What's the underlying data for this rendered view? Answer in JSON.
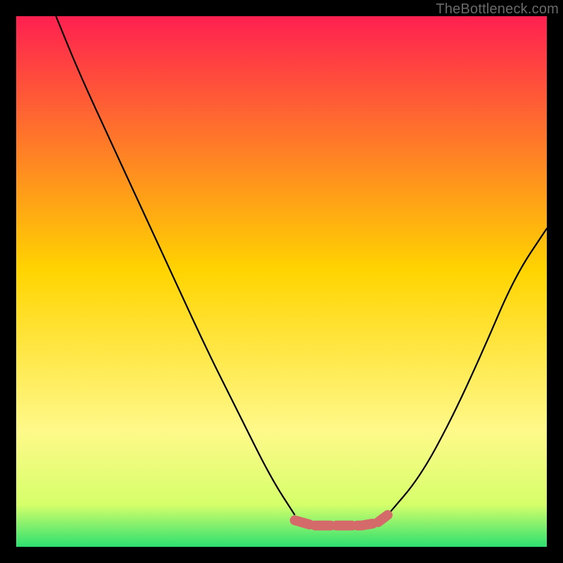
{
  "watermark": "TheBottleneck.com",
  "chart_data": {
    "type": "line",
    "title": "",
    "xlabel": "",
    "ylabel": "",
    "xlim": [
      0,
      1
    ],
    "ylim": [
      0,
      1
    ],
    "series": [
      {
        "name": "curve-left",
        "x": [
          0.075,
          0.12,
          0.18,
          0.24,
          0.3,
          0.36,
          0.42,
          0.48,
          0.525
        ],
        "y": [
          1.0,
          0.89,
          0.76,
          0.63,
          0.5,
          0.37,
          0.25,
          0.13,
          0.06
        ]
      },
      {
        "name": "curve-right",
        "x": [
          0.7,
          0.76,
          0.82,
          0.88,
          0.94,
          1.0
        ],
        "y": [
          0.06,
          0.13,
          0.24,
          0.37,
          0.51,
          0.6
        ]
      },
      {
        "name": "bottom-marker-band",
        "x": [
          0.525,
          0.56,
          0.59,
          0.62,
          0.65,
          0.68,
          0.7
        ],
        "y": [
          0.05,
          0.04,
          0.04,
          0.04,
          0.04,
          0.045,
          0.06
        ]
      }
    ],
    "background_gradient_stops": [
      {
        "offset": 0.0,
        "color": "#ff2050"
      },
      {
        "offset": 0.48,
        "color": "#ffd400"
      },
      {
        "offset": 0.78,
        "color": "#fff98a"
      },
      {
        "offset": 0.92,
        "color": "#d6ff6a"
      },
      {
        "offset": 1.0,
        "color": "#2de070"
      }
    ],
    "marker_color": "#d46a6a"
  }
}
